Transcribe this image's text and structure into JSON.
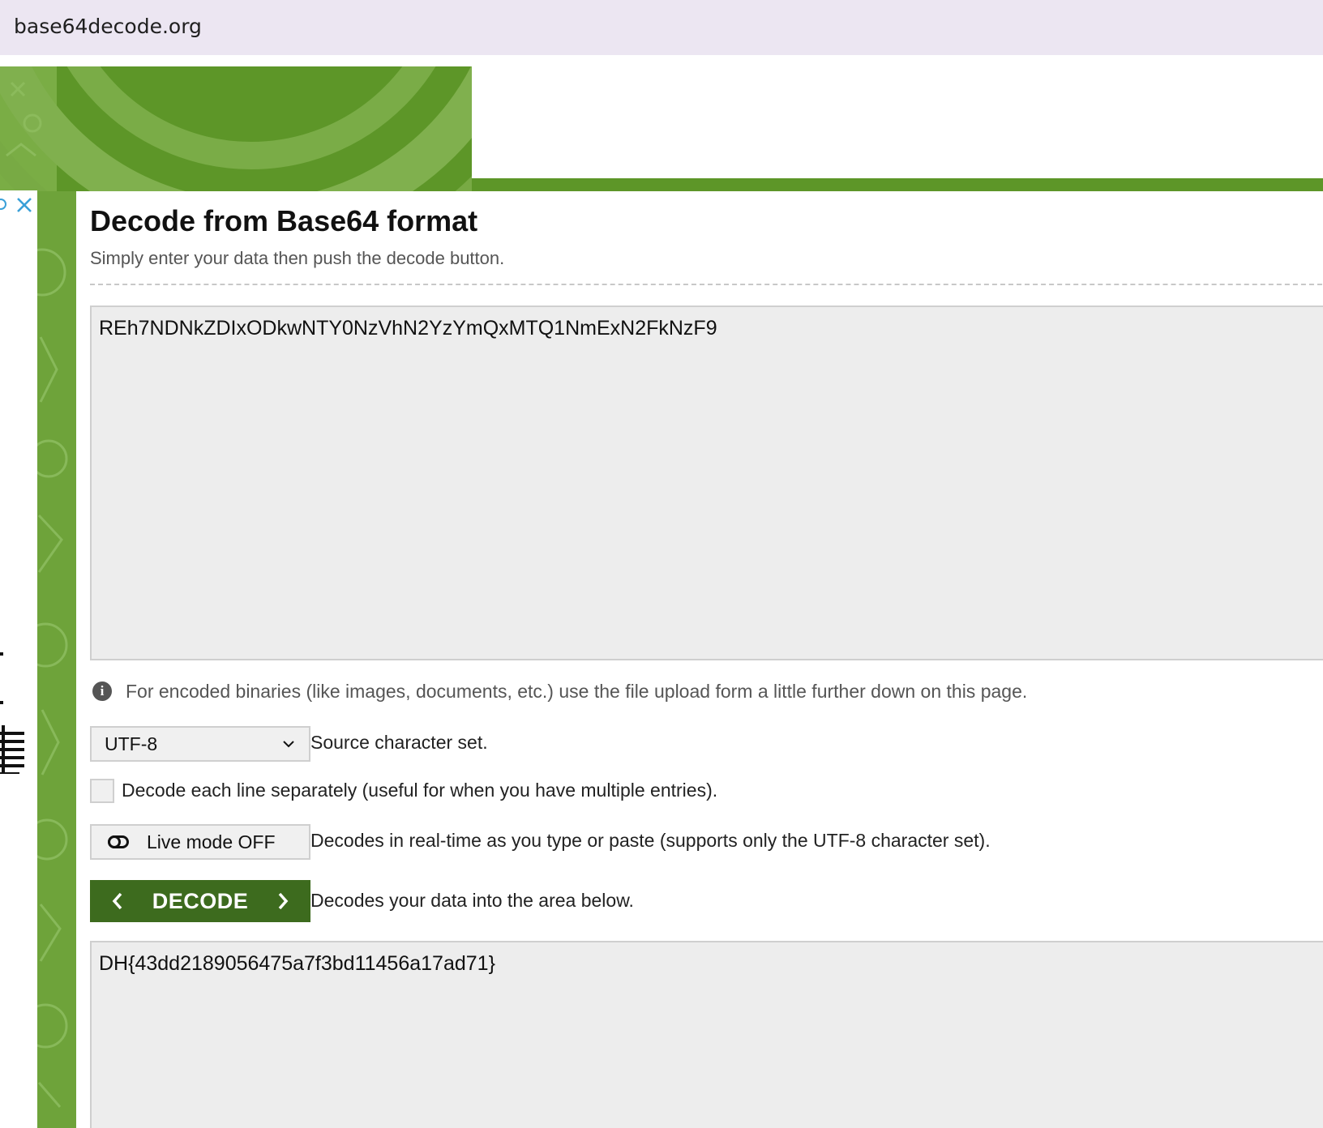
{
  "browser": {
    "url": "base64decode.org"
  },
  "main": {
    "title": "Decode from Base64 format",
    "subtitle": "Simply enter your data then push the decode button.",
    "input_value": "REh7NDNkZDIxODkwNTY0NzVhN2YzYmQxMTQ1NmExN2FkNzF9",
    "info_text": "For encoded binaries (like images, documents, etc.) use the file upload form a little further down on this page.",
    "charset": {
      "selected": "UTF-8",
      "label": "Source character set."
    },
    "decode_each_line": {
      "checked": false,
      "label": "Decode each line separately (useful for when you have multiple entries)."
    },
    "live_mode": {
      "button_label": "Live mode OFF",
      "description": "Decodes in real-time as you type or paste (supports only the UTF-8 character set)."
    },
    "decode": {
      "button_label": "DECODE",
      "description": "Decodes your data into the area below."
    },
    "output_value": "DH{43dd2189056475a7f3bd11456a17ad71}"
  },
  "icons": {
    "info": "info-icon",
    "close": "close-icon",
    "chevron_down": "chevron-down-icon",
    "toggle": "toggle-off-icon",
    "chevron_left": "chevron-left-icon",
    "chevron_right": "chevron-right-icon"
  },
  "colors": {
    "brand_green": "#6ea33a",
    "button_green": "#3d6b1e",
    "browser_bar": "#ece6f2"
  }
}
